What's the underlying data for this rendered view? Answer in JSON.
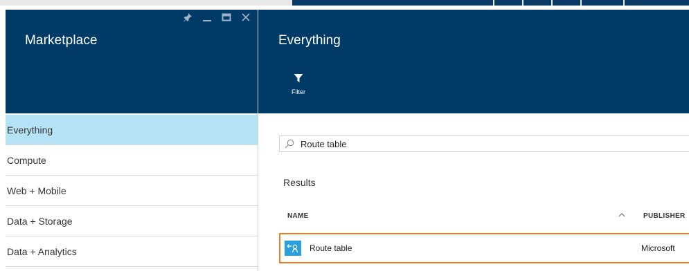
{
  "colors": {
    "header_bg": "#003a66",
    "selected_nav_bg": "#b5e3f5",
    "highlight_border": "#f07c1e",
    "resource_icon_bg": "#2aa1dc"
  },
  "marketplace_blade": {
    "title": "Marketplace",
    "controls": [
      {
        "name": "pin",
        "icon": "pin-icon"
      },
      {
        "name": "minimize",
        "icon": "minimize-icon"
      },
      {
        "name": "maximize",
        "icon": "maximize-icon"
      },
      {
        "name": "close",
        "icon": "close-icon"
      }
    ],
    "categories": [
      {
        "label": "Everything",
        "selected": true
      },
      {
        "label": "Compute",
        "selected": false
      },
      {
        "label": "Web + Mobile",
        "selected": false
      },
      {
        "label": "Data + Storage",
        "selected": false
      },
      {
        "label": "Data + Analytics",
        "selected": false
      }
    ]
  },
  "everything_blade": {
    "title": "Everything",
    "toolbar": {
      "filter_label": "Filter",
      "filter_icon": "filter-icon"
    },
    "search": {
      "value": "Route table",
      "icon": "search-icon"
    },
    "results_label": "Results",
    "columns": {
      "name": "NAME",
      "publisher": "PUBLISHER"
    },
    "rows": [
      {
        "name": "Route table",
        "publisher": "Microsoft",
        "icon": "route-table-icon"
      }
    ]
  }
}
